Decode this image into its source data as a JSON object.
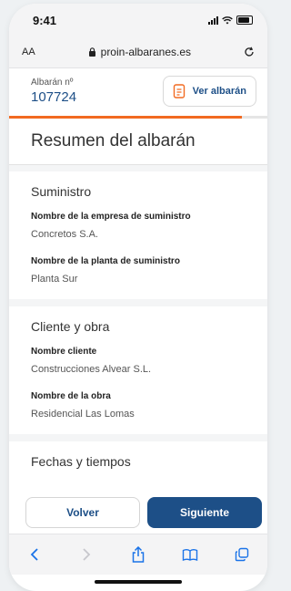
{
  "status_bar": {
    "time": "9:41"
  },
  "browser": {
    "text_size": "AA",
    "url": "proin-albaranes.es"
  },
  "header": {
    "albaran_label": "Albarán nº",
    "albaran_number": "107724",
    "view_button": "Ver albarán"
  },
  "progress": {
    "fraction": 0.9
  },
  "page": {
    "title": "Resumen del albarán"
  },
  "sections": [
    {
      "title": "Suministro",
      "fields": [
        {
          "label": "Nombre de la empresa de suministro",
          "value": "Concretos S.A."
        },
        {
          "label": "Nombre de la planta de suministro",
          "value": "Planta Sur"
        }
      ]
    },
    {
      "title": "Cliente y obra",
      "fields": [
        {
          "label": "Nombre cliente",
          "value": "Construcciones Alvear S.L."
        },
        {
          "label": "Nombre de la obra",
          "value": "Residencial Las Lomas"
        }
      ]
    },
    {
      "title": "Fechas y tiempos"
    }
  ],
  "footer": {
    "back": "Volver",
    "next": "Siguiente"
  },
  "toolbar": {
    "icons": [
      "back-icon",
      "forward-icon",
      "share-icon",
      "bookmarks-icon",
      "tabs-icon"
    ]
  },
  "colors": {
    "primary": "#1d4f87",
    "accent": "#f26a21"
  }
}
